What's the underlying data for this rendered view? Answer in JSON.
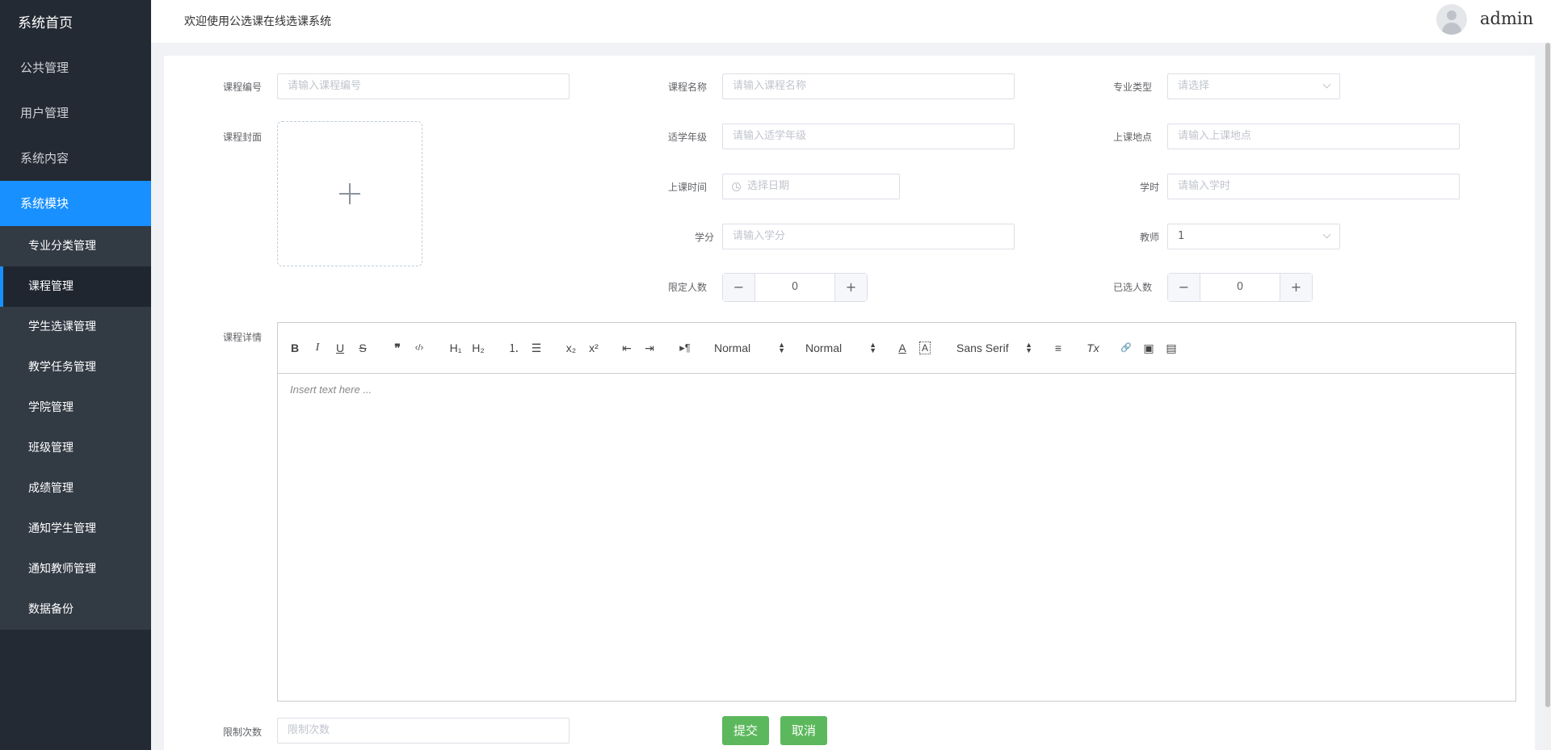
{
  "sidebar": {
    "home": "系统首页",
    "menu": [
      {
        "label": "公共管理"
      },
      {
        "label": "用户管理"
      },
      {
        "label": "系统内容"
      },
      {
        "label": "系统模块"
      }
    ],
    "submenu": [
      {
        "label": "专业分类管理"
      },
      {
        "label": "课程管理"
      },
      {
        "label": "学生选课管理"
      },
      {
        "label": "教学任务管理"
      },
      {
        "label": "学院管理"
      },
      {
        "label": "班级管理"
      },
      {
        "label": "成绩管理"
      },
      {
        "label": "通知学生管理"
      },
      {
        "label": "通知教师管理"
      },
      {
        "label": "数据备份"
      }
    ],
    "active_menu": "系统模块",
    "active_sub": "课程管理"
  },
  "header": {
    "welcome": "欢迎使用公选课在线选课系统",
    "username": "admin"
  },
  "form": {
    "course_no": {
      "label": "课程编号",
      "placeholder": "请输入课程编号"
    },
    "course_name": {
      "label": "课程名称",
      "placeholder": "请输入课程名称"
    },
    "major_type": {
      "label": "专业类型",
      "placeholder": "请选择"
    },
    "cover": {
      "label": "课程封面"
    },
    "grade": {
      "label": "适学年级",
      "placeholder": "请输入适学年级"
    },
    "location": {
      "label": "上课地点",
      "placeholder": "请输入上课地点"
    },
    "class_time": {
      "label": "上课时间",
      "placeholder": "选择日期"
    },
    "hours": {
      "label": "学时",
      "placeholder": "请输入学时"
    },
    "credit": {
      "label": "学分",
      "placeholder": "请输入学分"
    },
    "teacher": {
      "label": "教师",
      "value": "1"
    },
    "limit_count": {
      "label": "限定人数",
      "value": "0",
      "minus": "−",
      "plus": "+"
    },
    "selected_count": {
      "label": "已选人数",
      "value": "0",
      "minus": "−",
      "plus": "+"
    },
    "details": {
      "label": "课程详情",
      "placeholder": "Insert text here ..."
    },
    "limit_times": {
      "label": "限制次数",
      "placeholder": "限制次数"
    },
    "submit": "提交",
    "cancel": "取消"
  },
  "editor_toolbar": {
    "bold": "B",
    "italic": "I",
    "underline": "U",
    "strike": "S",
    "blockquote": "❞",
    "code": "‹/›",
    "h1": "H₁",
    "h2": "H₂",
    "ordered_list": "⒈",
    "bullet_list": "☰",
    "subscript": "x₂",
    "superscript": "x²",
    "outdent": "⇤",
    "indent": "⇥",
    "direction": "▸¶",
    "size_select": "Normal",
    "header_select": "Normal",
    "font_color": "A",
    "background": "A",
    "font_select": "Sans Serif",
    "align": "≡",
    "clean": "Tx",
    "link": "🔗",
    "image": "▣",
    "video": "▤"
  }
}
